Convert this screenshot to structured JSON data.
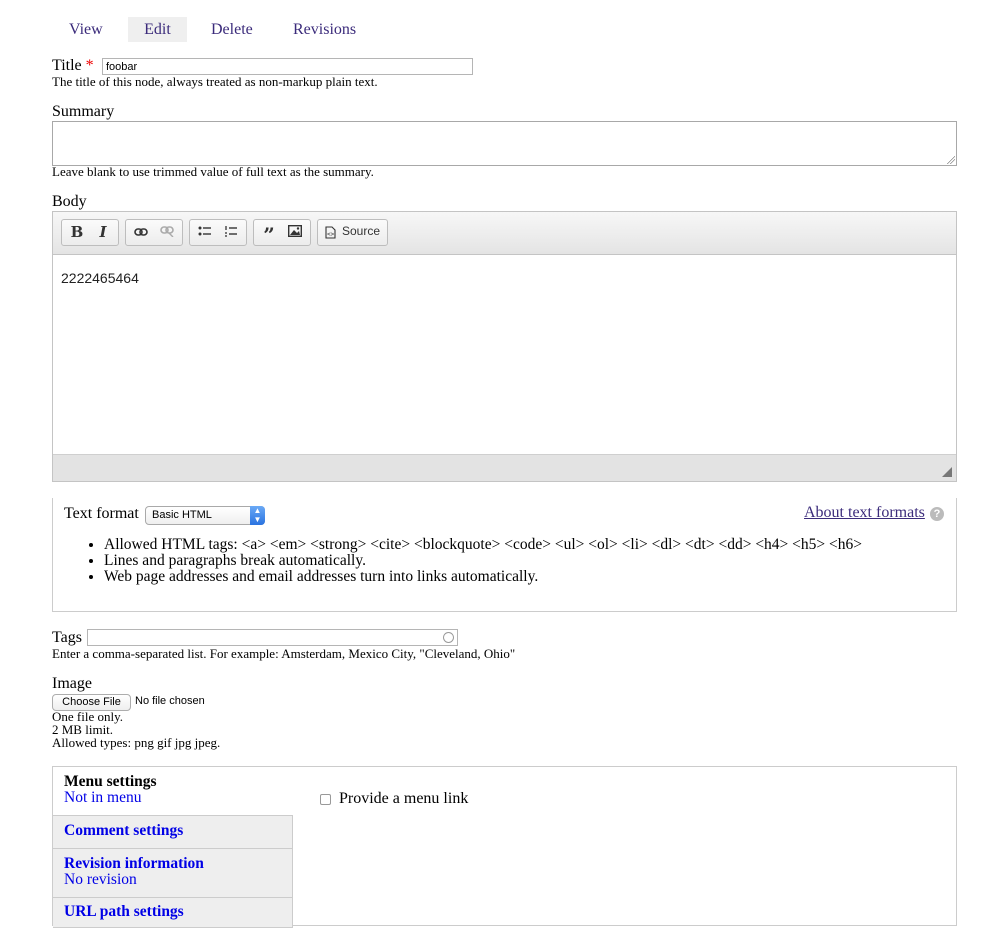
{
  "tabs": [
    {
      "label": "View"
    },
    {
      "label": "Edit"
    },
    {
      "label": "Delete"
    },
    {
      "label": "Revisions"
    }
  ],
  "title_field": {
    "label": "Title",
    "required_mark": "*",
    "value": "foobar",
    "description": "The title of this node, always treated as non-markup plain text."
  },
  "summary_field": {
    "label": "Summary",
    "value": "",
    "description": "Leave blank to use trimmed value of full text as the summary."
  },
  "body_field": {
    "label": "Body",
    "toolbar": {
      "bold": "B",
      "italic": "I",
      "source_label": "Source"
    },
    "content": "2222465464"
  },
  "text_format": {
    "label": "Text format",
    "selected": "Basic HTML",
    "about_link": "About text formats",
    "tips": [
      "Allowed HTML tags: <a> <em> <strong> <cite> <blockquote> <code> <ul> <ol> <li> <dl> <dt> <dd> <h4> <h5> <h6>",
      "Lines and paragraphs break automatically.",
      "Web page addresses and email addresses turn into links automatically."
    ]
  },
  "tags_field": {
    "label": "Tags",
    "value": "",
    "description": "Enter a comma-separated list. For example: Amsterdam, Mexico City, \"Cleveland, Ohio\""
  },
  "image_field": {
    "label": "Image",
    "button_label": "Choose File",
    "file_status": "No file chosen",
    "notes": [
      "One file only.",
      "2 MB limit.",
      "Allowed types: png gif jpg jpeg."
    ]
  },
  "vertical_tabs": [
    {
      "title": "Menu settings",
      "summary": "Not in menu"
    },
    {
      "title": "Comment settings",
      "summary": ""
    },
    {
      "title": "Revision information",
      "summary": "No revision"
    },
    {
      "title": "URL path settings",
      "summary": ""
    }
  ],
  "menu_pane": {
    "checkbox_label": "Provide a menu link",
    "checked": false
  },
  "colors": {
    "tab_link": "#3b2b7b",
    "vertical_tab_link": "#0000e6",
    "required": "#ee0000"
  }
}
